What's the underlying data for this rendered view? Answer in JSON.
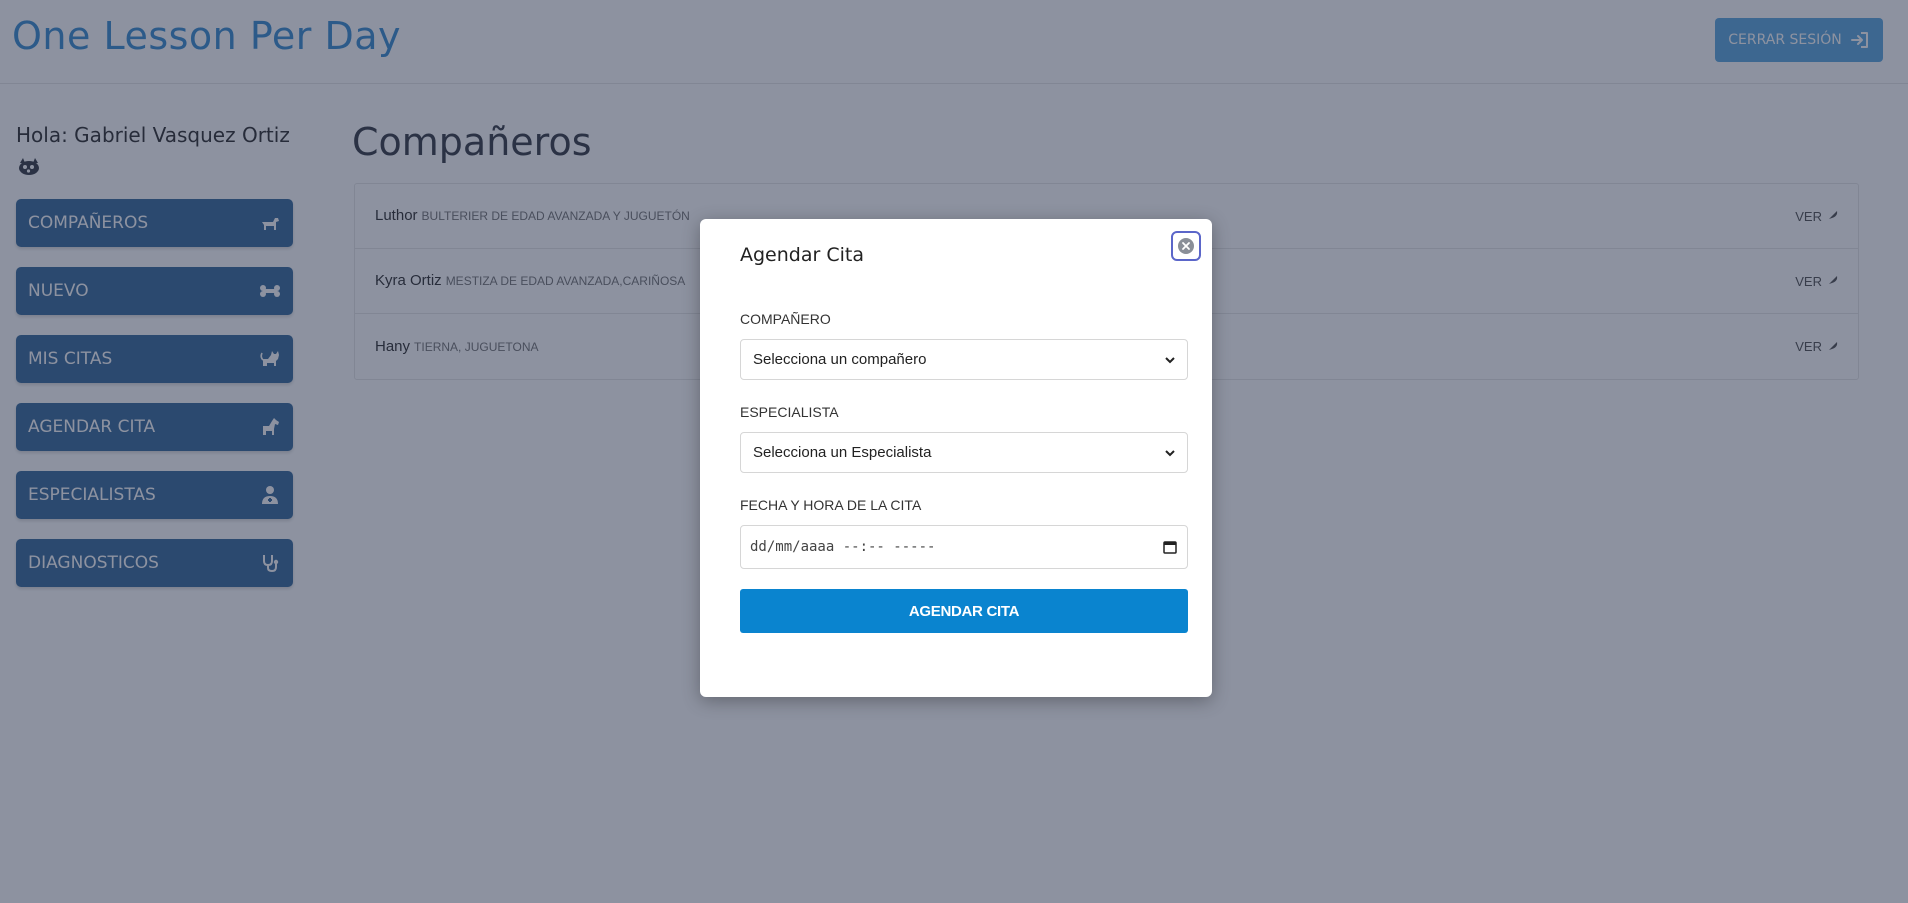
{
  "header": {
    "brand": "One Lesson Per Day",
    "logout_label": "CERRAR SESIÓN"
  },
  "sidebar": {
    "greeting": "Hola: Gabriel Vasquez Ortiz",
    "items": [
      {
        "label": "COMPAÑEROS",
        "icon": "dog-icon"
      },
      {
        "label": "NUEVO",
        "icon": "bone-icon"
      },
      {
        "label": "MIS CITAS",
        "icon": "cat-icon"
      },
      {
        "label": "AGENDAR CITA",
        "icon": "horse-icon"
      },
      {
        "label": "ESPECIALISTAS",
        "icon": "user-doctor-icon"
      },
      {
        "label": "DIAGNOSTICOS",
        "icon": "stethoscope-icon"
      }
    ]
  },
  "main": {
    "title": "Compañeros",
    "rows": [
      {
        "name": "Luthor",
        "desc": "BULTERIER DE EDAD AVANZADA Y JUGUETÓN",
        "link": "VER"
      },
      {
        "name": "Kyra Ortiz",
        "desc": "MESTIZA DE EDAD AVANZADA,CARIÑOSA",
        "link": "VER"
      },
      {
        "name": "Hany",
        "desc": "TIERNA, JUGUETONA",
        "link": "VER"
      }
    ]
  },
  "modal": {
    "title": "Agendar Cita",
    "companion_label": "COMPAÑERO",
    "companion_value": "Selecciona un compañero",
    "specialist_label": "ESPECIALISTA",
    "specialist_value": "Selecciona un Especialista",
    "datetime_label": "FECHA Y HORA DE LA CITA",
    "datetime_value": "dd/mm/aaaa --:-- -----",
    "submit_label": "AGENDAR CITA"
  },
  "colors": {
    "brand": "#3d8fd0",
    "sidebar_button": "#3a6d9c",
    "primary_button": "#0a84cf",
    "overlay": "#1c2642"
  }
}
